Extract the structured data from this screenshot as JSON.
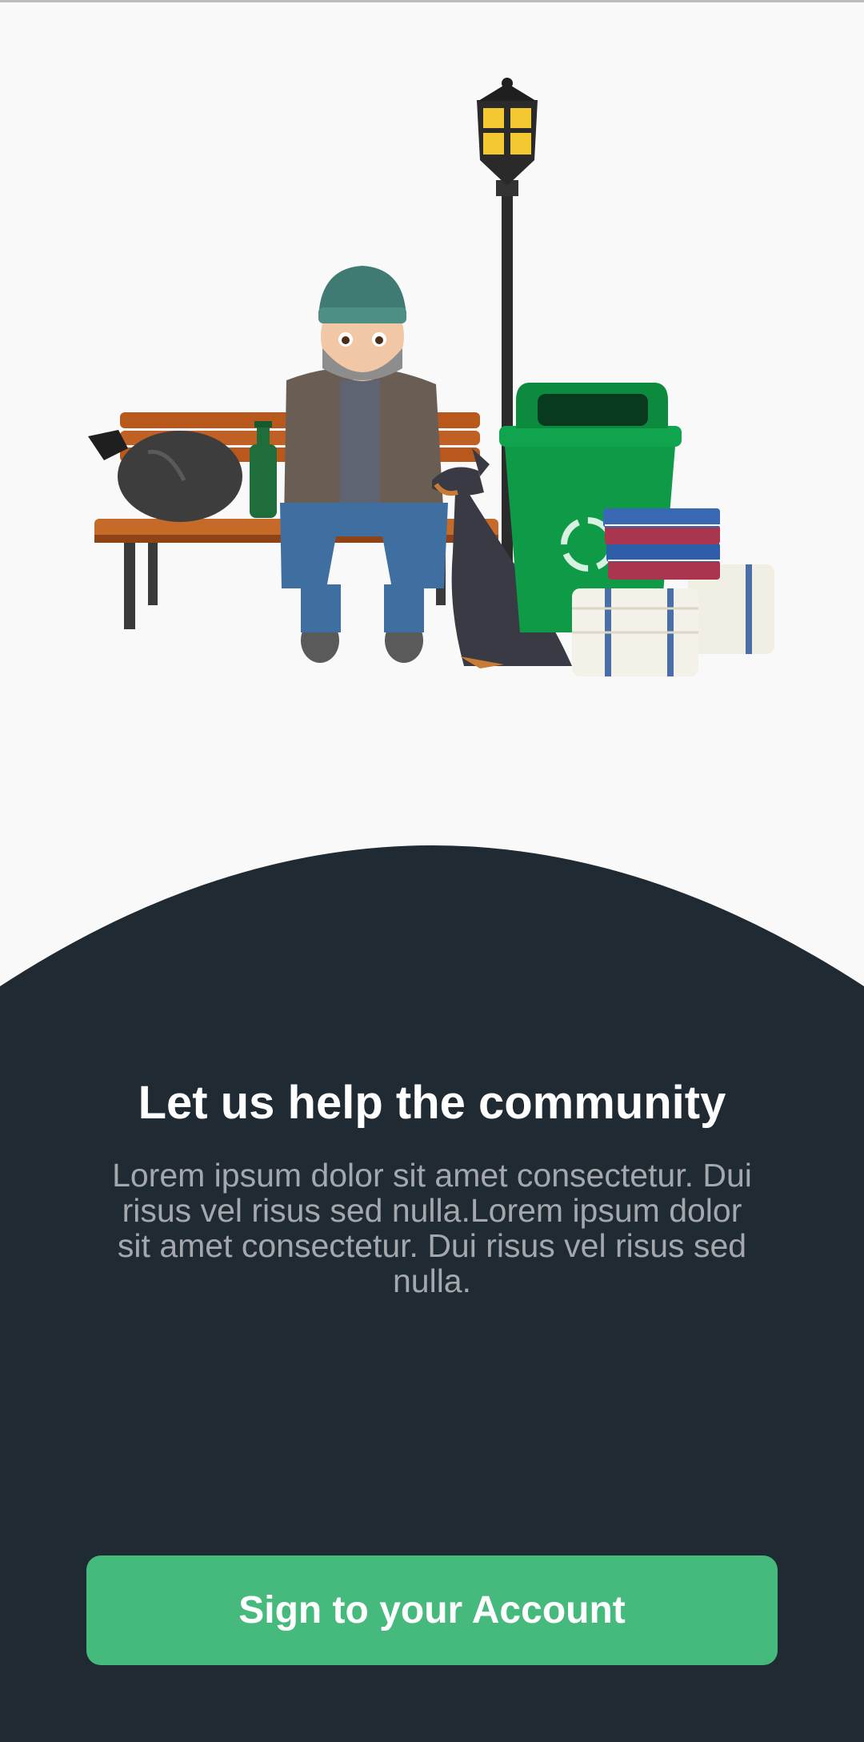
{
  "onboarding": {
    "title": "Let us help the community",
    "description": "Lorem ipsum dolor sit amet consectetur. Dui risus vel risus sed nulla.Lorem ipsum dolor sit amet consectetur. Dui risus vel risus sed nulla.",
    "cta_label": "Sign to your Account"
  },
  "colors": {
    "background": "#f9f9f9",
    "panel": "#1f2a33",
    "title": "#ffffff",
    "description": "#a4a8ad",
    "cta_background": "#46b97d",
    "cta_text": "#ffffff"
  },
  "illustration": {
    "icon": "homeless-man-on-bench-illustration",
    "elements": [
      "garbage-bag",
      "green-bottle",
      "park-bench",
      "man-in-beanie",
      "street-lamp",
      "doberman-dog",
      "recycle-bin",
      "book-stack",
      "newspaper-bundles"
    ]
  }
}
